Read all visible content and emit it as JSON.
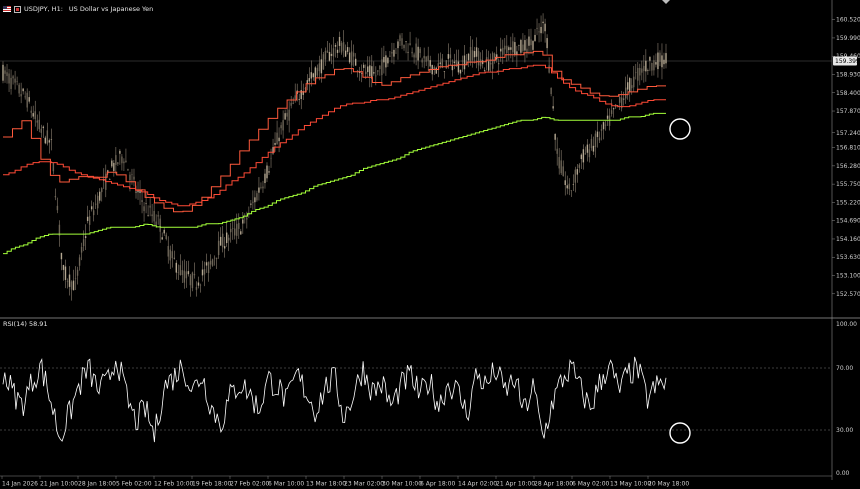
{
  "header": {
    "symbol": "USDJPY, H1:",
    "description": "US Dollar vs Japanese Yen"
  },
  "rsi_header": {
    "label": "RSI(14) 58.91"
  },
  "current_price_tag": "159.399",
  "colors": {
    "background": "#000000",
    "candles": "#a89a86",
    "ma_fast": "#ff5a3c",
    "ma_mid": "#ff4a36",
    "ma_slow": "#a4ff3a",
    "rsi_line": "#ffffff"
  },
  "chart_data": [
    {
      "type": "line",
      "title": "USDJPY, H1: US Dollar vs Japanese Yen",
      "ylim": [
        152.1,
        160.8
      ],
      "yticks": [
        "160.520",
        "159.990",
        "159.460",
        "158.930",
        "158.400",
        "157.870",
        "157.240",
        "156.810",
        "156.280",
        "155.750",
        "155.220",
        "154.690",
        "154.160",
        "153.630",
        "153.100",
        "152.570"
      ],
      "xticks": [
        "14 Jan 2026",
        "21 Jan 10:00",
        "28 Jan 18:00",
        "5 Feb 02:00",
        "12 Feb 10:00",
        "19 Feb 18:00",
        "27 Feb 02:00",
        "6 Mar 10:00",
        "13 Mar 18:00",
        "23 Mar 02:00",
        "30 Mar 10:00",
        "6 Apr 18:00",
        "14 Apr 02:00",
        "21 Apr 10:00",
        "28 Apr 18:00",
        "6 May 02:00",
        "13 May 10:00",
        "20 May 18:00"
      ],
      "series": [
        {
          "kind": "price",
          "values": [
            159.0,
            158.6,
            158.2,
            157.4,
            156.9,
            153.2,
            152.8,
            154.6,
            155.4,
            156.2,
            156.6,
            155.6,
            155.0,
            154.6,
            153.6,
            153.1,
            152.9,
            153.3,
            154.0,
            154.3,
            154.6,
            155.4,
            156.2,
            157.3,
            158.0,
            158.6,
            159.0,
            159.5,
            159.8,
            159.4,
            159.0,
            158.9,
            159.5,
            159.9,
            159.7,
            159.3,
            159.1,
            159.3,
            159.2,
            159.6,
            159.2,
            159.4,
            159.8,
            159.7,
            159.9,
            160.4,
            156.5,
            155.5,
            156.5,
            156.9,
            157.4,
            158.0,
            158.6,
            159.1,
            159.3,
            159.4
          ]
        },
        {
          "kind": "ma_fast",
          "values": [
            157.0,
            157.3,
            157.6,
            156.9,
            156.1,
            155.8,
            155.9,
            156.0,
            155.9,
            156.1,
            156.0,
            155.7,
            155.4,
            155.2,
            155.0,
            154.9,
            155.1,
            155.4,
            155.8,
            156.2,
            156.7,
            157.1,
            157.5,
            157.9,
            158.2,
            158.5,
            158.8,
            158.9,
            159.1,
            159.1,
            158.9,
            158.7,
            158.6,
            158.8,
            158.9,
            159.0,
            159.1,
            159.2,
            159.2,
            159.3,
            159.3,
            159.4,
            159.5,
            159.5,
            159.6,
            159.6,
            159.0,
            158.7,
            158.6,
            158.4,
            158.3,
            158.3,
            158.4,
            158.5,
            158.6,
            158.6
          ]
        },
        {
          "kind": "ma_mid",
          "values": [
            156.0,
            156.1,
            156.3,
            156.4,
            156.4,
            156.3,
            156.1,
            156.0,
            155.9,
            155.8,
            155.7,
            155.6,
            155.5,
            155.3,
            155.2,
            155.1,
            155.2,
            155.3,
            155.5,
            155.8,
            156.0,
            156.3,
            156.6,
            156.9,
            157.1,
            157.4,
            157.6,
            157.8,
            158.0,
            158.1,
            158.1,
            158.2,
            158.2,
            158.3,
            158.4,
            158.5,
            158.6,
            158.7,
            158.8,
            158.9,
            159.0,
            159.0,
            159.1,
            159.1,
            159.2,
            159.2,
            158.9,
            158.6,
            158.4,
            158.3,
            158.1,
            158.0,
            158.0,
            158.1,
            158.2,
            158.2
          ]
        },
        {
          "kind": "ma_slow",
          "values": [
            153.7,
            153.9,
            154.0,
            154.2,
            154.3,
            154.3,
            154.3,
            154.3,
            154.4,
            154.5,
            154.5,
            154.5,
            154.6,
            154.5,
            154.5,
            154.5,
            154.5,
            154.6,
            154.6,
            154.7,
            154.8,
            155.0,
            155.1,
            155.3,
            155.4,
            155.5,
            155.7,
            155.8,
            155.9,
            156.0,
            156.2,
            156.3,
            156.4,
            156.5,
            156.7,
            156.8,
            156.9,
            157.0,
            157.1,
            157.2,
            157.3,
            157.4,
            157.5,
            157.6,
            157.6,
            157.7,
            157.6,
            157.6,
            157.6,
            157.6,
            157.6,
            157.6,
            157.7,
            157.7,
            157.8,
            157.8
          ]
        }
      ]
    },
    {
      "type": "line",
      "title": "RSI(14) 58.91",
      "ylim": [
        0,
        100
      ],
      "yticks": [
        "100.00",
        "70.00",
        "30.00",
        "0.00"
      ],
      "levels": [
        70,
        30
      ],
      "series": [
        {
          "name": "RSI(14)",
          "values": [
            68,
            55,
            46,
            60,
            72,
            50,
            25,
            40,
            58,
            70,
            56,
            60,
            78,
            52,
            35,
            44,
            26,
            58,
            64,
            72,
            55,
            66,
            45,
            34,
            52,
            60,
            54,
            43,
            63,
            58,
            48,
            66,
            55,
            42,
            57,
            64,
            38,
            53,
            70,
            55,
            60,
            45,
            58,
            66,
            52,
            62,
            46,
            60,
            55,
            40,
            67,
            58,
            69,
            55,
            63,
            42,
            58,
            24,
            48,
            62,
            70,
            56,
            44,
            60,
            73,
            55,
            66,
            70,
            50,
            58,
            61
          ]
        }
      ]
    }
  ]
}
